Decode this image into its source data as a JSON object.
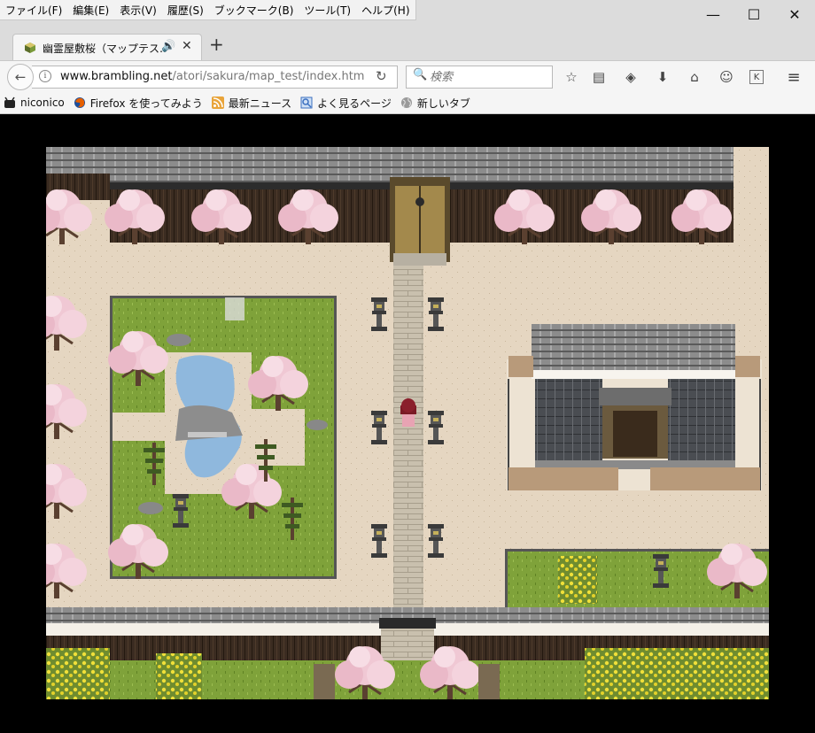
{
  "menu": [
    "ファイル(F)",
    "編集(E)",
    "表示(V)",
    "履歴(S)",
    "ブックマーク(B)",
    "ツール(T)",
    "ヘルプ(H)"
  ],
  "window_controls": {
    "minimize": "—",
    "maximize": "☐",
    "close": "✕"
  },
  "tab": {
    "title": "幽霊屋敷桜（マップテス…",
    "audio_icon": "🔊",
    "close_icon": "✕"
  },
  "newtab_icon": "+",
  "nav": {
    "back_icon": "←",
    "url_host": "www.brambling.net",
    "url_path": "/atori/sakura/map_test/index.htm",
    "reload_icon": "↻",
    "search_placeholder": "検索",
    "search_icon": "🔍"
  },
  "toolbar_icons": [
    "☆",
    "▤",
    "◈",
    "⬇",
    "⌂",
    "☺",
    "K",
    "≡"
  ],
  "bookmarks": [
    {
      "label": "niconico",
      "icon": "niconico-icon",
      "color": "#222222"
    },
    {
      "label": "Firefox を使ってみよう",
      "icon": "firefox-icon",
      "color": "#e66000"
    },
    {
      "label": "最新ニュース",
      "icon": "rss-icon",
      "color": "#e9a43a"
    },
    {
      "label": "よく見るページ",
      "icon": "folder-search-icon",
      "color": "#3a6fc0"
    },
    {
      "label": "新しいタブ",
      "icon": "globe-icon",
      "color": "#777777"
    }
  ],
  "colors": {
    "ground": "#e5d6c1",
    "grass": "#7fa23a",
    "roof": "#6b6b6b",
    "wall_wood": "#3b2c21",
    "path": "#c9c0ae",
    "sakura": "#f0c8d4"
  }
}
